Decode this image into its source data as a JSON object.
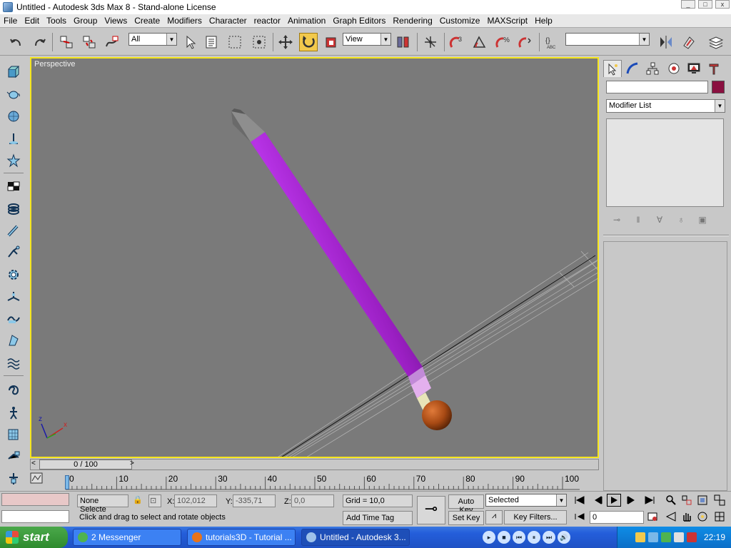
{
  "window": {
    "title": "Untitled - Autodesk 3ds Max 8  - Stand-alone License",
    "controls": [
      "minimize",
      "maximize",
      "close"
    ]
  },
  "menu": [
    "File",
    "Edit",
    "Tools",
    "Group",
    "Views",
    "Create",
    "Modifiers",
    "Character",
    "reactor",
    "Animation",
    "Graph Editors",
    "Rendering",
    "Customize",
    "MAXScript",
    "Help"
  ],
  "toolbar": {
    "selection_filter": "All",
    "reference_coord": "View",
    "named_selection": "",
    "icons": [
      "undo-icon",
      "redo-icon",
      "select-and-link-icon",
      "unlink-icon",
      "bind-space-warp-icon",
      "select-object-icon",
      "select-by-name-icon",
      "rectangular-selection-icon",
      "window-crossing-icon",
      "select-and-move-icon",
      "select-and-rotate-icon",
      "select-and-scale-icon",
      "pivot-icon",
      "manipulate-icon",
      "snap-3d-icon",
      "angle-snap-icon",
      "percent-snap-icon",
      "spinner-snap-icon",
      "edit-named-selection-icon",
      "mirror-icon",
      "align-icon",
      "layer-manager-icon"
    ],
    "active": "select-and-rotate-icon",
    "accent_color": "#f2c94c"
  },
  "viewport": {
    "label": "Perspective",
    "axis_labels": {
      "z": "z",
      "x": "x"
    },
    "border_color": "#f5e51d",
    "object_color": "#9a1fc2"
  },
  "command_panel": {
    "name_value": "",
    "object_color": "#8a1040",
    "modifier_list": "Modifier List"
  },
  "time_slider": {
    "label": "0 / 100",
    "ticks": [
      "0",
      "10",
      "20",
      "30",
      "40",
      "50",
      "60",
      "70",
      "80",
      "90",
      "100"
    ]
  },
  "status": {
    "selection": "None Selecte",
    "x_label": "X:",
    "x_value": "102,012",
    "y_label": "Y:",
    "y_value": "-335,71",
    "z_label": "Z:",
    "z_value": "0,0",
    "grid": "Grid = 10,0",
    "prompt": "Click and drag to select and rotate objects",
    "add_time_tag": "Add Time Tag",
    "auto_key": "Auto Key",
    "set_key": "Set Key",
    "key_mode": "Selected",
    "key_filters": "Key Filters...",
    "frame": "0"
  },
  "taskbar": {
    "start": "start",
    "tasks": [
      {
        "label": "2 Messenger",
        "active": false
      },
      {
        "label": "tutorials3D - Tutorial ...",
        "active": false
      },
      {
        "label": "Untitled - Autodesk 3...",
        "active": true
      }
    ],
    "clock": "22:19"
  }
}
